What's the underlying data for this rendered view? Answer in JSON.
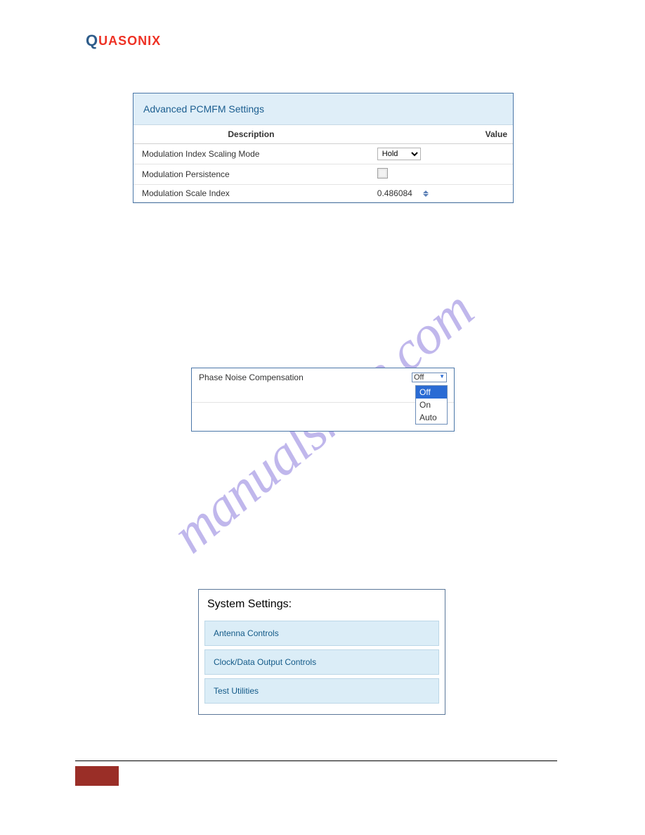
{
  "logo": {
    "q": "Q",
    "rest": "UASONIX"
  },
  "pcmfm": {
    "title": "Advanced PCMFM Settings",
    "columns": {
      "description": "Description",
      "value": "Value"
    },
    "rows": [
      {
        "label": "Modulation Index Scaling Mode",
        "control": "select",
        "value": "Hold"
      },
      {
        "label": "Modulation Persistence",
        "control": "checkbox",
        "value": ""
      },
      {
        "label": "Modulation Scale Index",
        "control": "number",
        "value": "0.486084"
      }
    ]
  },
  "pnc": {
    "label": "Phase Noise Compensation",
    "selected": "Off",
    "options": [
      "Off",
      "On",
      "Auto"
    ]
  },
  "sys": {
    "title": "System Settings:",
    "items": [
      "Antenna Controls",
      "Clock/Data Output Controls",
      "Test Utilities"
    ]
  },
  "watermark": "manualshive.com"
}
